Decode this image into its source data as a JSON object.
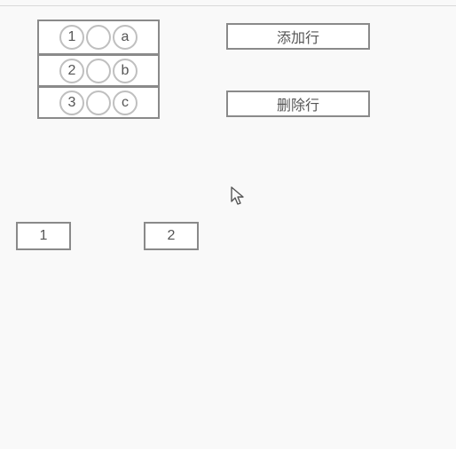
{
  "grid": {
    "rows": [
      {
        "left": "1",
        "mid": "",
        "right": "a"
      },
      {
        "left": "2",
        "mid": "",
        "right": "b"
      },
      {
        "left": "3",
        "mid": "",
        "right": "c"
      }
    ]
  },
  "buttons": {
    "add_row": "添加行",
    "delete_row": "删除行"
  },
  "bottom_boxes": {
    "box1": "1",
    "box2": "2"
  }
}
